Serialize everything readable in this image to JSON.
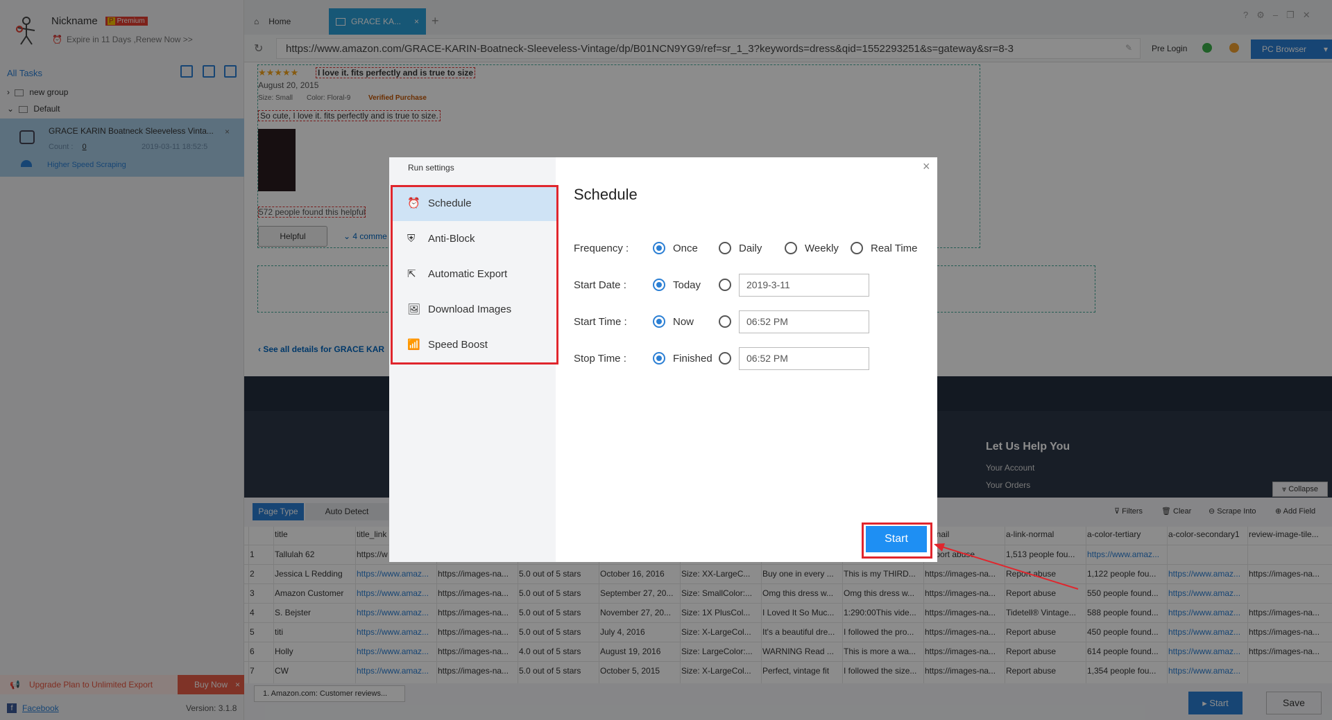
{
  "sidebar": {
    "nickname": "Nickname",
    "badge": "Premium",
    "badge_prefix": "P",
    "expire": "Expire in 11 Days ,Renew Now >>",
    "all_tasks": "All Tasks",
    "tree": [
      "new group",
      "Default"
    ],
    "task": {
      "title": "GRACE KARIN Boatneck Sleeveless Vinta...",
      "count_label": "Count :",
      "count_value": "0",
      "date": "2019-03-11 18:52:5",
      "speed": "Higher Speed Scraping"
    },
    "upgrade": "Upgrade Plan to Unlimited Export",
    "buy_now": "Buy Now",
    "facebook": "Facebook",
    "version": "Version: 3.1.8"
  },
  "tabs": {
    "home": "Home",
    "active": "GRACE KA...",
    "new": "+"
  },
  "url": "https://www.amazon.com/GRACE-KARIN-Boatneck-Sleeveless-Vintage/dp/B01NCN9YG9/ref=sr_1_3?keywords=dress&qid=1552293251&s=gateway&sr=8-3",
  "toolbar": {
    "pre_login": "Pre Login",
    "pc_browser": "PC Browser"
  },
  "web": {
    "review_title": "I love it. fits perfectly and is true to size",
    "review_date": "August 20, 2015",
    "size": "Size: Small",
    "color": "Color: Floral-9",
    "verified": "Verified Purchase",
    "review_body": "So cute, I love it. fits perfectly and is true to size.",
    "helpful_count": "572 people found this helpful",
    "helpful_btn": "Helpful",
    "comments": "4 comme",
    "see_all": "‹ See all details for GRACE KAR",
    "help_heading": "Let Us Help You",
    "help_links": [
      "Your Account",
      "Your Orders"
    ],
    "stars": "★★★★★"
  },
  "bottom": {
    "page_type": "Page Type",
    "auto_detect": "Auto Detect",
    "collapse": "Collapse",
    "filters": "Filters",
    "clear": "Clear",
    "scrape_into": "Scrape Into",
    "add_field": "Add Field",
    "sheet_tab": "1. Amazon.com: Customer reviews...",
    "start": "Start",
    "save": "Save",
    "columns": [
      "title",
      "title_link",
      "",
      "",
      "",
      "",
      "",
      "",
      "mbnail",
      "a-link-normal",
      "a-color-tertiary",
      "a-color-secondary1",
      "review-image-tile..."
    ],
    "rows": [
      [
        "1",
        "Tallulah 62",
        "https://w",
        "",
        "",
        "",
        "",
        "",
        "",
        "Report abuse",
        "1,513 people fou...",
        "https://www.amaz...",
        ""
      ],
      [
        "2",
        "Jessica L Redding",
        "https://www.amaz...",
        "https://images-na...",
        "5.0 out of 5 stars",
        "October 16, 2016",
        "Size: XX-LargeC...",
        "Buy one in every ...",
        "This is my THIRD...",
        "https://images-na...",
        "Report abuse",
        "1,122 people fou...",
        "https://www.amaz...",
        "https://images-na..."
      ],
      [
        "3",
        "Amazon Customer",
        "https://www.amaz...",
        "https://images-na...",
        "5.0 out of 5 stars",
        "September 27, 20...",
        "Size: SmallColor:...",
        "Omg this dress w...",
        "Omg this dress w...",
        "https://images-na...",
        "Report abuse",
        "550 people found...",
        "https://www.amaz...",
        ""
      ],
      [
        "4",
        "S. Bejster",
        "https://www.amaz...",
        "https://images-na...",
        "5.0 out of 5 stars",
        "November 27, 20...",
        "Size: 1X PlusCol...",
        "I Loved It So Muc...",
        "1:290:00This vide...",
        "https://images-na...",
        "Tidetell® Vintage...",
        "588 people found...",
        "https://www.amaz...",
        "https://images-na..."
      ],
      [
        "5",
        "titi",
        "https://www.amaz...",
        "https://images-na...",
        "5.0 out of 5 stars",
        "July 4, 2016",
        "Size: X-LargeCol...",
        "It's a beautiful dre...",
        "I followed the pro...",
        "https://images-na...",
        "Report abuse",
        "450 people found...",
        "https://www.amaz...",
        "https://images-na..."
      ],
      [
        "6",
        "Holly",
        "https://www.amaz...",
        "https://images-na...",
        "4.0 out of 5 stars",
        "August 19, 2016",
        "Size: LargeColor:...",
        "WARNING Read ...",
        "This is more a wa...",
        "https://images-na...",
        "Report abuse",
        "614 people found...",
        "https://www.amaz...",
        "https://images-na..."
      ],
      [
        "7",
        "CW",
        "https://www.amaz...",
        "https://images-na...",
        "5.0 out of 5 stars",
        "October 5, 2015",
        "Size: X-LargeCol...",
        "Perfect, vintage fit",
        "I followed the size...",
        "https://images-na...",
        "Report abuse",
        "1,354 people fou...",
        "https://www.amaz...",
        ""
      ]
    ]
  },
  "dialog": {
    "header": "Run settings",
    "menu": [
      "Schedule",
      "Anti-Block",
      "Automatic Export",
      "Download Images",
      "Speed Boost"
    ],
    "title": "Schedule",
    "frequency_label": "Frequency :",
    "frequency_options": [
      "Once",
      "Daily",
      "Weekly",
      "Real Time"
    ],
    "start_date_label": "Start Date :",
    "start_date_option": "Today",
    "start_date_value": "2019-3-11",
    "start_time_label": "Start Time :",
    "start_time_option": "Now",
    "start_time_value": "06:52  PM",
    "stop_time_label": "Stop Time :",
    "stop_time_option": "Finished",
    "stop_time_value": "06:52  PM",
    "start_button": "Start",
    "close": "×"
  },
  "colors": {
    "accent": "#2b7fd4",
    "highlight": "#e0262d",
    "start_button": "#1e8ff3"
  }
}
